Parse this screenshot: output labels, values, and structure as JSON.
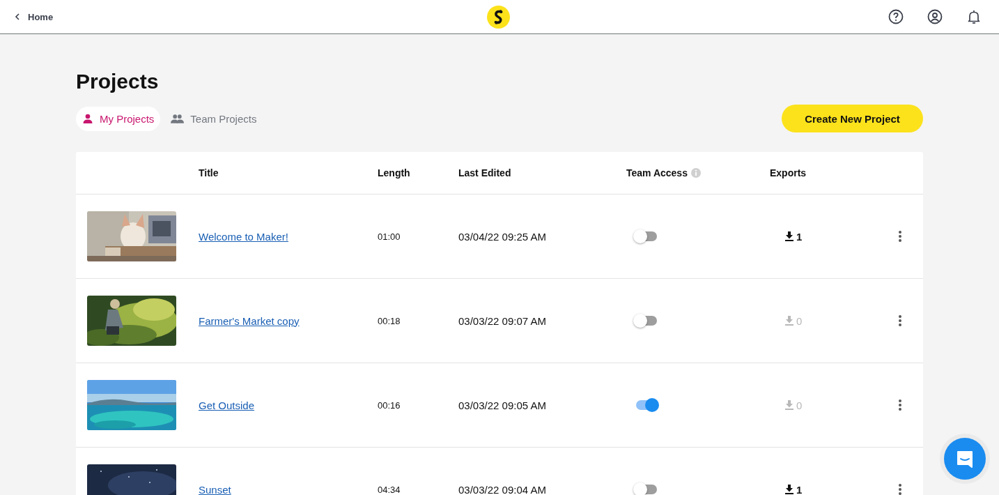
{
  "header": {
    "back_link": "Home"
  },
  "page": {
    "title": "Projects"
  },
  "tabs": [
    {
      "label": "My Projects",
      "selected": true
    },
    {
      "label": "Team Projects",
      "selected": false
    }
  ],
  "create_button": "Create New Project",
  "table": {
    "columns": [
      "Title",
      "Length",
      "Last Edited",
      "Team Access",
      "Exports"
    ],
    "rows": [
      {
        "title": "Welcome to Maker!",
        "length": "01:00",
        "last_edited": "03/04/22 09:25 AM",
        "team_access": false,
        "exports": {
          "count": "1",
          "disabled": false
        }
      },
      {
        "title": "Farmer's Market copy",
        "length": "00:18",
        "last_edited": "03/03/22 09:07 AM",
        "team_access": false,
        "exports": {
          "count": "0",
          "disabled": true
        }
      },
      {
        "title": "Get Outside",
        "length": "00:16",
        "last_edited": "03/03/22 09:05 AM",
        "team_access": true,
        "exports": {
          "count": "0",
          "disabled": true
        }
      },
      {
        "title": "Sunset",
        "length": "04:34",
        "last_edited": "03/03/22 09:04 AM",
        "team_access": false,
        "exports": {
          "count": "1",
          "disabled": false
        }
      }
    ]
  }
}
